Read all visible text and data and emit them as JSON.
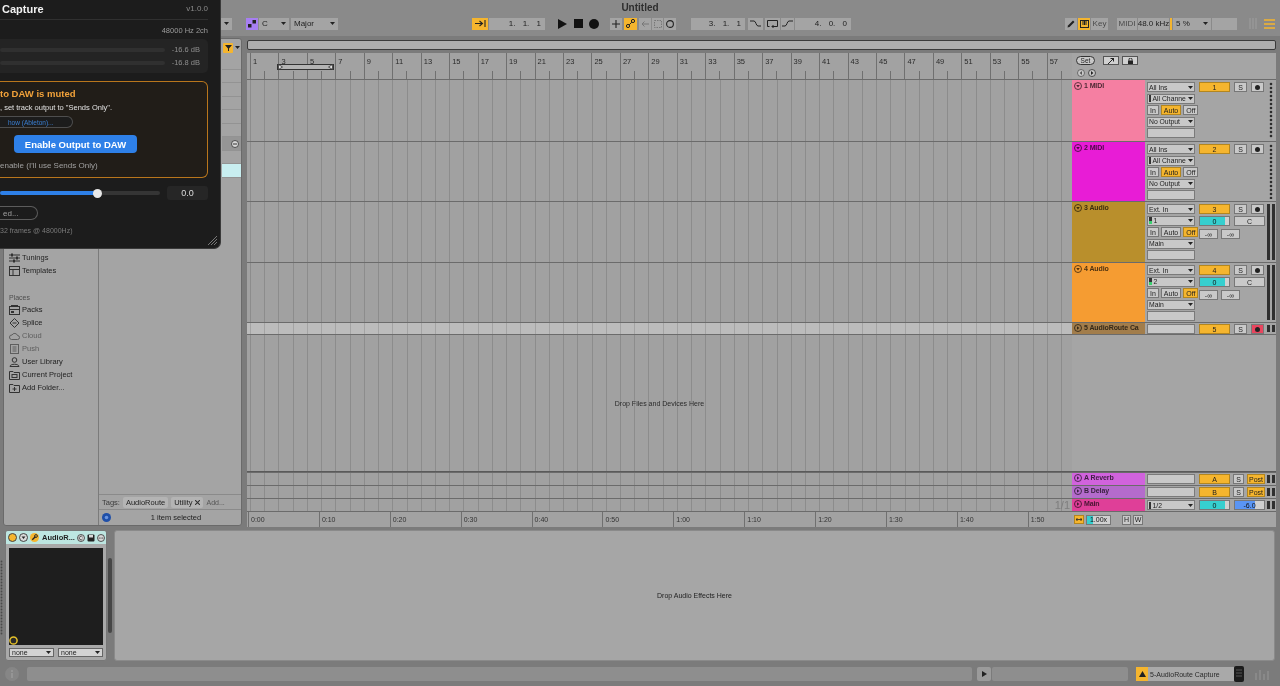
{
  "plugin": {
    "title": "Capture",
    "version": "v1.0.0",
    "format": "48000 Hz 2ch",
    "meters": [
      {
        "reading": "-16.6 dB"
      },
      {
        "reading": "-16.8 dB"
      }
    ],
    "warning": {
      "heading": "to DAW is muted",
      "text": ", set track output to \"Sends Only\".",
      "link": "how (Ableton)...",
      "button": "Enable Output to DAW",
      "dismiss": "enable (I'll use Sends Only)"
    },
    "gain": {
      "level": 0.61,
      "value": "0.0"
    },
    "button": "ed...",
    "footer": "32 frames @ 48000Hz)"
  },
  "toolbar": {
    "title": "Untitled",
    "scale_mode": {
      "on": true
    },
    "key": "C",
    "scale": "Major",
    "follow": {
      "on": true
    },
    "position": "1. 1. 1",
    "overdub": {
      "on": false
    },
    "automation_arm": {
      "on": true
    },
    "reenable_automation": {
      "on": false
    },
    "capture_midi": {
      "on": false
    },
    "session_record": {
      "on": false
    },
    "loop_start": "3. 1. 1",
    "punch_in": {
      "on": false
    },
    "loop": {
      "on": false
    },
    "punch_out": {
      "on": false
    },
    "loop_length": "4. 0. 0",
    "draw_mode": {
      "on": false
    },
    "computer_keyboard": {
      "on": true
    },
    "key_map": {
      "label": "Key",
      "on": false
    },
    "midi_map": {
      "label": "MIDI",
      "on": false
    },
    "sample_rate": "48.0 kHz",
    "cpu": "5 %"
  },
  "browser": {
    "categories": [
      {
        "kind": "tunings",
        "label": "Tunings",
        "disabled": false
      },
      {
        "kind": "templates",
        "label": "Templates",
        "disabled": false
      }
    ],
    "places_heading": "Places",
    "places": [
      {
        "kind": "packs",
        "label": "Packs",
        "disabled": false
      },
      {
        "kind": "splice",
        "label": "Splice",
        "disabled": false
      },
      {
        "kind": "cloud",
        "label": "Cloud",
        "disabled": true
      },
      {
        "kind": "push",
        "label": "Push",
        "disabled": true
      },
      {
        "kind": "user_library",
        "label": "User Library",
        "disabled": false
      },
      {
        "kind": "project",
        "label": "Current Project",
        "disabled": false
      },
      {
        "kind": "add_folder",
        "label": "Add Folder...",
        "disabled": false
      }
    ],
    "filter": {
      "on": true
    },
    "rows": [
      {
        "kind": "item",
        "selected": false
      },
      {
        "kind": "item",
        "selected": false
      },
      {
        "kind": "item",
        "selected": false
      },
      {
        "kind": "item",
        "selected": false
      },
      {
        "kind": "item",
        "selected": false
      },
      {
        "kind": "item",
        "selected": false
      },
      {
        "kind": "group",
        "selected": false
      },
      {
        "kind": "item",
        "selected": false
      },
      {
        "kind": "item",
        "selected": true
      }
    ],
    "tags_label": "Tags:",
    "tags": [
      {
        "label": "AudioRoute",
        "removable": false
      },
      {
        "label": "Utility",
        "removable": true
      }
    ],
    "tag_placeholder": "Add...",
    "selection": "1 item selected"
  },
  "arrangement": {
    "bars": [
      "1",
      "3",
      "5",
      "7",
      "9",
      "11",
      "13",
      "15",
      "17",
      "19",
      "21",
      "23",
      "25",
      "27",
      "29",
      "31",
      "33",
      "35",
      "37",
      "39",
      "41",
      "43",
      "45",
      "47",
      "49",
      "51",
      "53",
      "55",
      "57"
    ],
    "locator_label": "Set",
    "tracks": [
      {
        "kind": "midi",
        "name": "1 MIDI",
        "color": "#f57fa2",
        "expanded": true,
        "selected": false,
        "input": "All Ins",
        "channel": "All Channe",
        "monitor": [
          {
            "label": "In",
            "selected": false
          },
          {
            "label": "Auto",
            "selected": true
          },
          {
            "label": "Off",
            "selected": false
          }
        ],
        "output": "No Output",
        "number": "1",
        "active": true,
        "solo_label": "S",
        "solo": false,
        "armed": false
      },
      {
        "kind": "midi",
        "name": "2 MIDI",
        "color": "#e81cd6",
        "expanded": true,
        "selected": false,
        "input": "All Ins",
        "channel": "All Channe",
        "monitor": [
          {
            "label": "In",
            "selected": false
          },
          {
            "label": "Auto",
            "selected": true
          },
          {
            "label": "Off",
            "selected": false
          }
        ],
        "output": "No Output",
        "number": "2",
        "active": true,
        "solo_label": "S",
        "solo": false,
        "armed": false
      },
      {
        "kind": "audio",
        "name": "3 Audio",
        "color": "#b98f2c",
        "expanded": true,
        "selected": false,
        "input": "Ext. In",
        "channel": "1",
        "monitor": [
          {
            "label": "In",
            "selected": false
          },
          {
            "label": "Auto",
            "selected": false
          },
          {
            "label": "Off",
            "selected": true
          }
        ],
        "output": "Main",
        "number": "3",
        "active": true,
        "solo_label": "S",
        "solo": false,
        "armed": false,
        "volume": {
          "value": "0",
          "level": 0.87
        },
        "pan": "C",
        "sends": [
          "-∞",
          "-∞"
        ]
      },
      {
        "kind": "audio",
        "name": "4 Audio",
        "color": "#f59c32",
        "expanded": true,
        "selected": false,
        "input": "Ext. In",
        "channel": "2",
        "monitor": [
          {
            "label": "In",
            "selected": false
          },
          {
            "label": "Auto",
            "selected": false
          },
          {
            "label": "Off",
            "selected": true
          }
        ],
        "output": "Main",
        "number": "4",
        "active": true,
        "solo_label": "S",
        "solo": false,
        "armed": false,
        "volume": {
          "value": "0",
          "level": 0.87
        },
        "pan": "C",
        "sends": [
          "-∞",
          "-∞"
        ]
      },
      {
        "kind": "folded",
        "name": "5 AudioRoute Ca",
        "color": "#a27d4b",
        "expanded": false,
        "selected": true,
        "number": "5",
        "active": true,
        "solo_label": "S",
        "solo": false,
        "armed": true
      }
    ],
    "drop_hint": "Drop Files and Devices Here",
    "returns": [
      {
        "kind": "return",
        "name": "A Reverb",
        "color": "#d163dd",
        "expanded": false,
        "number": "A",
        "active": true,
        "solo_label": "S",
        "solo": false,
        "post_label": "Post",
        "post": true
      },
      {
        "kind": "return",
        "name": "B Delay",
        "color": "#b46bcc",
        "expanded": false,
        "number": "B",
        "active": true,
        "solo_label": "S",
        "solo": false,
        "post_label": "Post",
        "post": true
      },
      {
        "kind": "main",
        "name": "Main",
        "color": "#df3f98",
        "expanded": false,
        "output": "1/2",
        "volume": {
          "value": "0",
          "level": 0.87
        },
        "cue": {
          "value": "-6.0",
          "level": 0.7
        }
      }
    ],
    "grid_label": "1/1",
    "times": [
      "0:00",
      "0:10",
      "0:20",
      "0:30",
      "0:40",
      "0:50",
      "1:00",
      "1:10",
      "1:20",
      "1:30",
      "1:40",
      "1:50"
    ],
    "follow_toggle": {
      "on": true
    },
    "speed": {
      "value": "1.00x",
      "level": 0.27
    },
    "height_button": "H",
    "width_button": "W"
  },
  "detail": {
    "device": {
      "name": "AudioR...",
      "on": true,
      "selected": true,
      "routings": [
        "none",
        "none"
      ]
    },
    "drop_hint": "Drop Audio Effects Here"
  },
  "status_bar": {
    "warning": {
      "on": true
    },
    "track": "5-AudioRoute Capture"
  }
}
